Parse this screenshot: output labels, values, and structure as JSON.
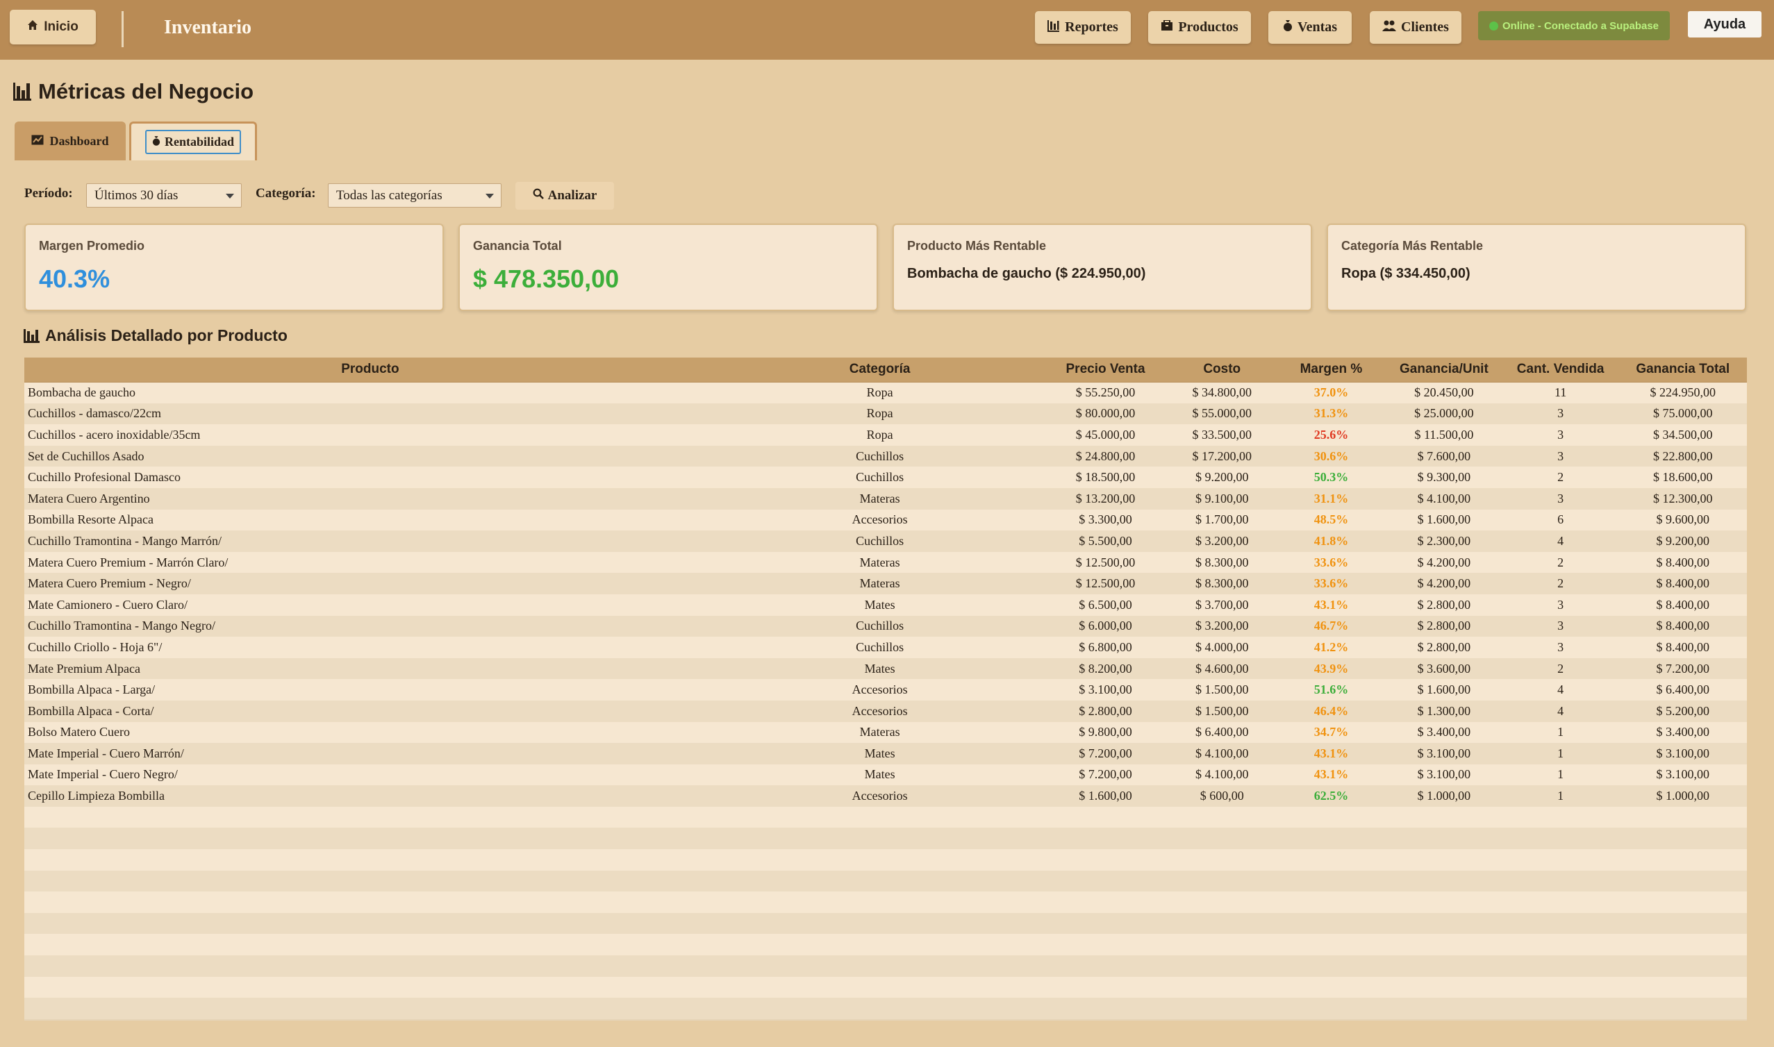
{
  "colors": {
    "topbar": "#b98b55",
    "background": "#e6cca3",
    "accent_blue": "#2f8fdc",
    "accent_green": "#3cae3a",
    "margin_orange": "#f0920f",
    "margin_red": "#e03a22",
    "status_bg": "#7d8a3e"
  },
  "topbar": {
    "home_label": "Inicio",
    "home_icon": "house-icon",
    "app_title": "Inventario",
    "nav": [
      {
        "label": "Reportes",
        "icon": "bar-chart-icon"
      },
      {
        "label": "Productos",
        "icon": "box-icon"
      },
      {
        "label": "Ventas",
        "icon": "money-bag-icon"
      },
      {
        "label": "Clientes",
        "icon": "people-icon"
      }
    ],
    "status": "Online - Conectado a Supabase",
    "help_label": "Ayuda"
  },
  "page": {
    "title": "Métricas del Negocio",
    "tabs": [
      {
        "label": "Dashboard",
        "icon": "line-chart-icon",
        "active": false
      },
      {
        "label": "Rentabilidad",
        "icon": "money-bag-icon",
        "active": true
      }
    ]
  },
  "filters": {
    "period_label": "Período:",
    "period_value": "Últimos 30 días",
    "category_label": "Categoría:",
    "category_value": "Todas las categorías",
    "analyze_label": "Analizar"
  },
  "cards": {
    "avg_margin_label": "Margen Promedio",
    "avg_margin_value": "40.3%",
    "total_profit_label": "Ganancia Total",
    "total_profit_value": "$ 478.350,00",
    "top_product_label": "Producto Más Rentable",
    "top_product_value": "Bombacha de gaucho ($ 224.950,00)",
    "top_category_label": "Categoría Más Rentable",
    "top_category_value": "Ropa ($ 334.450,00)"
  },
  "analysis": {
    "title": "Análisis Detallado por Producto",
    "columns": [
      "Producto",
      "Categoría",
      "Precio Venta",
      "Costo",
      "Margen %",
      "Ganancia/Unit",
      "Cant. Vendida",
      "Ganancia Total"
    ],
    "rows": [
      [
        "Bombacha de gaucho",
        "Ropa",
        "$ 55.250,00",
        "$ 34.800,00",
        "37.0%",
        "$ 20.450,00",
        "11",
        "$ 224.950,00"
      ],
      [
        "Cuchillos - damasco/22cm",
        "Ropa",
        "$ 80.000,00",
        "$ 55.000,00",
        "31.3%",
        "$ 25.000,00",
        "3",
        "$ 75.000,00"
      ],
      [
        "Cuchillos - acero inoxidable/35cm",
        "Ropa",
        "$ 45.000,00",
        "$ 33.500,00",
        "25.6%",
        "$ 11.500,00",
        "3",
        "$ 34.500,00"
      ],
      [
        "Set de Cuchillos Asado",
        "Cuchillos",
        "$ 24.800,00",
        "$ 17.200,00",
        "30.6%",
        "$ 7.600,00",
        "3",
        "$ 22.800,00"
      ],
      [
        "Cuchillo Profesional Damasco",
        "Cuchillos",
        "$ 18.500,00",
        "$ 9.200,00",
        "50.3%",
        "$ 9.300,00",
        "2",
        "$ 18.600,00"
      ],
      [
        "Matera Cuero Argentino",
        "Materas",
        "$ 13.200,00",
        "$ 9.100,00",
        "31.1%",
        "$ 4.100,00",
        "3",
        "$ 12.300,00"
      ],
      [
        "Bombilla Resorte Alpaca",
        "Accesorios",
        "$ 3.300,00",
        "$ 1.700,00",
        "48.5%",
        "$ 1.600,00",
        "6",
        "$ 9.600,00"
      ],
      [
        "Cuchillo Tramontina - Mango Marrón/",
        "Cuchillos",
        "$ 5.500,00",
        "$ 3.200,00",
        "41.8%",
        "$ 2.300,00",
        "4",
        "$ 9.200,00"
      ],
      [
        "Matera Cuero Premium - Marrón Claro/",
        "Materas",
        "$ 12.500,00",
        "$ 8.300,00",
        "33.6%",
        "$ 4.200,00",
        "2",
        "$ 8.400,00"
      ],
      [
        "Matera Cuero Premium - Negro/",
        "Materas",
        "$ 12.500,00",
        "$ 8.300,00",
        "33.6%",
        "$ 4.200,00",
        "2",
        "$ 8.400,00"
      ],
      [
        "Mate Camionero - Cuero Claro/",
        "Mates",
        "$ 6.500,00",
        "$ 3.700,00",
        "43.1%",
        "$ 2.800,00",
        "3",
        "$ 8.400,00"
      ],
      [
        "Cuchillo Tramontina - Mango Negro/",
        "Cuchillos",
        "$ 6.000,00",
        "$ 3.200,00",
        "46.7%",
        "$ 2.800,00",
        "3",
        "$ 8.400,00"
      ],
      [
        "Cuchillo Criollo - Hoja 6\"/",
        "Cuchillos",
        "$ 6.800,00",
        "$ 4.000,00",
        "41.2%",
        "$ 2.800,00",
        "3",
        "$ 8.400,00"
      ],
      [
        "Mate Premium Alpaca",
        "Mates",
        "$ 8.200,00",
        "$ 4.600,00",
        "43.9%",
        "$ 3.600,00",
        "2",
        "$ 7.200,00"
      ],
      [
        "Bombilla Alpaca - Larga/",
        "Accesorios",
        "$ 3.100,00",
        "$ 1.500,00",
        "51.6%",
        "$ 1.600,00",
        "4",
        "$ 6.400,00"
      ],
      [
        "Bombilla Alpaca - Corta/",
        "Accesorios",
        "$ 2.800,00",
        "$ 1.500,00",
        "46.4%",
        "$ 1.300,00",
        "4",
        "$ 5.200,00"
      ],
      [
        "Bolso Matero Cuero",
        "Materas",
        "$ 9.800,00",
        "$ 6.400,00",
        "34.7%",
        "$ 3.400,00",
        "1",
        "$ 3.400,00"
      ],
      [
        "Mate Imperial - Cuero Marrón/",
        "Mates",
        "$ 7.200,00",
        "$ 4.100,00",
        "43.1%",
        "$ 3.100,00",
        "1",
        "$ 3.100,00"
      ],
      [
        "Mate Imperial - Cuero Negro/",
        "Mates",
        "$ 7.200,00",
        "$ 4.100,00",
        "43.1%",
        "$ 3.100,00",
        "1",
        "$ 3.100,00"
      ],
      [
        "Cepillo Limpieza Bombilla",
        "Accesorios",
        "$ 1.600,00",
        "$ 600,00",
        "62.5%",
        "$ 1.000,00",
        "1",
        "$ 1.000,00"
      ]
    ],
    "margin_levels": [
      "orange",
      "orange",
      "red",
      "orange",
      "green",
      "orange",
      "orange",
      "orange",
      "orange",
      "orange",
      "orange",
      "orange",
      "orange",
      "orange",
      "green",
      "orange",
      "orange",
      "orange",
      "orange",
      "green"
    ]
  }
}
